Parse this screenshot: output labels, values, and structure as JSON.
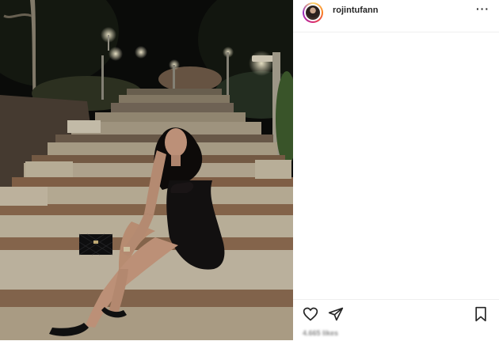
{
  "post": {
    "username": "rojintufann",
    "more_glyph": "···",
    "likes_text": "4.665 likes",
    "icons": [
      "heart-icon",
      "share-icon",
      "bookmark-icon",
      "more-options-icon"
    ]
  }
}
